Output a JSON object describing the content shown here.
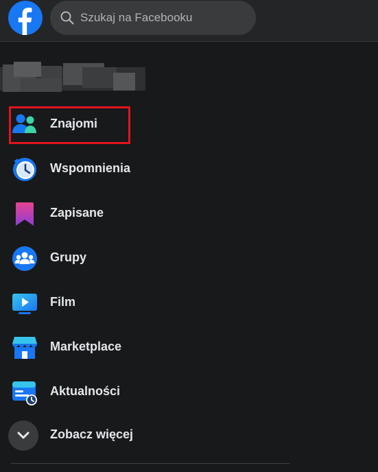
{
  "header": {
    "logo_icon": "facebook-logo-icon",
    "search": {
      "placeholder": "Szukaj na Facebooku",
      "icon": "search-icon"
    }
  },
  "sidebar": {
    "items": [
      {
        "label": "Znajomi",
        "icon": "friends-icon",
        "highlighted": true
      },
      {
        "label": "Wspomnienia",
        "icon": "memories-clock-icon"
      },
      {
        "label": "Zapisane",
        "icon": "saved-bookmark-icon"
      },
      {
        "label": "Grupy",
        "icon": "groups-icon"
      },
      {
        "label": "Film",
        "icon": "video-play-icon"
      },
      {
        "label": "Marketplace",
        "icon": "marketplace-store-icon"
      },
      {
        "label": "Aktualności",
        "icon": "news-feed-icon"
      },
      {
        "label": "Zobacz więcej",
        "icon": "chevron-down-icon"
      }
    ]
  },
  "colors": {
    "background": "#18191a",
    "topbar": "#242526",
    "search_bg": "#3a3b3c",
    "text": "#e4e6eb",
    "highlight": "#e3141e",
    "facebook_blue": "#1877f2"
  }
}
